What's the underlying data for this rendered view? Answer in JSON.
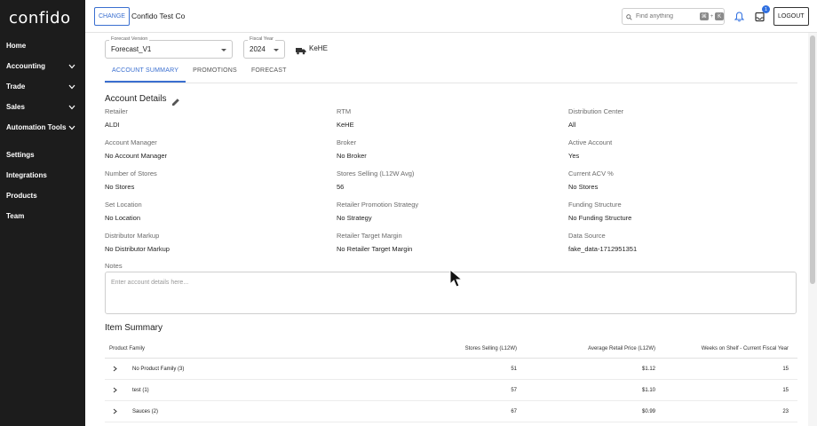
{
  "sidebar": {
    "logo": "confido",
    "items": [
      {
        "label": "Home",
        "expandable": false
      },
      {
        "label": "Accounting",
        "expandable": true
      },
      {
        "label": "Trade",
        "expandable": true
      },
      {
        "label": "Sales",
        "expandable": true
      },
      {
        "label": "Automation Tools",
        "expandable": true
      },
      {
        "label": "Settings",
        "expandable": false
      },
      {
        "label": "Integrations",
        "expandable": false
      },
      {
        "label": "Products",
        "expandable": false
      },
      {
        "label": "Team",
        "expandable": false
      }
    ]
  },
  "header": {
    "change_label": "CHANGE",
    "company": "Confido Test Co",
    "search_placeholder": "Find anything",
    "shortcut_key1": "⌘",
    "shortcut_sep": "+",
    "shortcut_key2": "K",
    "notification_count": "1",
    "logout_label": "LOGOUT"
  },
  "filters": {
    "forecast_version_label": "Forecast Version",
    "forecast_version_value": "Forecast_V1",
    "fiscal_year_label": "Fiscal Year",
    "fiscal_year_value": "2024",
    "distributor": "KeHE"
  },
  "tabs": [
    {
      "label": "ACCOUNT SUMMARY",
      "active": true
    },
    {
      "label": "PROMOTIONS",
      "active": false
    },
    {
      "label": "FORECAST",
      "active": false
    }
  ],
  "account_details": {
    "title": "Account Details",
    "fields": [
      {
        "label": "Retailer",
        "value": "ALDI"
      },
      {
        "label": "RTM",
        "value": "KeHE"
      },
      {
        "label": "Distribution Center",
        "value": "All"
      },
      {
        "label": "Account Manager",
        "value": "No Account Manager"
      },
      {
        "label": "Broker",
        "value": "No Broker"
      },
      {
        "label": "Active Account",
        "value": "Yes"
      },
      {
        "label": "Number of Stores",
        "value": "No Stores"
      },
      {
        "label": "Stores Selling (L12W Avg)",
        "value": "56"
      },
      {
        "label": "Current ACV %",
        "value": "No Stores"
      },
      {
        "label": "Set Location",
        "value": "No Location"
      },
      {
        "label": "Retailer Promotion Strategy",
        "value": "No Strategy"
      },
      {
        "label": "Funding Structure",
        "value": "No Funding Structure"
      },
      {
        "label": "Distributor Markup",
        "value": "No Distributor Markup"
      },
      {
        "label": "Retailer Target Margin",
        "value": "No Retailer Target Margin"
      },
      {
        "label": "Data Source",
        "value": "fake_data-1712951351"
      }
    ],
    "notes_label": "Notes",
    "notes_placeholder": "Enter account details here..."
  },
  "item_summary": {
    "title": "Item Summary",
    "columns": [
      "Product Family",
      "Stores Selling (L12W)",
      "Average Retail Price (L12W)",
      "Weeks on Shelf - Current Fiscal Year"
    ],
    "rows": [
      {
        "family": "No Product Family (3)",
        "stores": "51",
        "price": "$1.12",
        "weeks": "15"
      },
      {
        "family": "test (1)",
        "stores": "57",
        "price": "$1.10",
        "weeks": "15"
      },
      {
        "family": "Sauces (2)",
        "stores": "67",
        "price": "$0.99",
        "weeks": "23"
      }
    ]
  },
  "colors": {
    "sidebar_bg": "#1c1c1c",
    "accent": "#3a6fd0"
  }
}
